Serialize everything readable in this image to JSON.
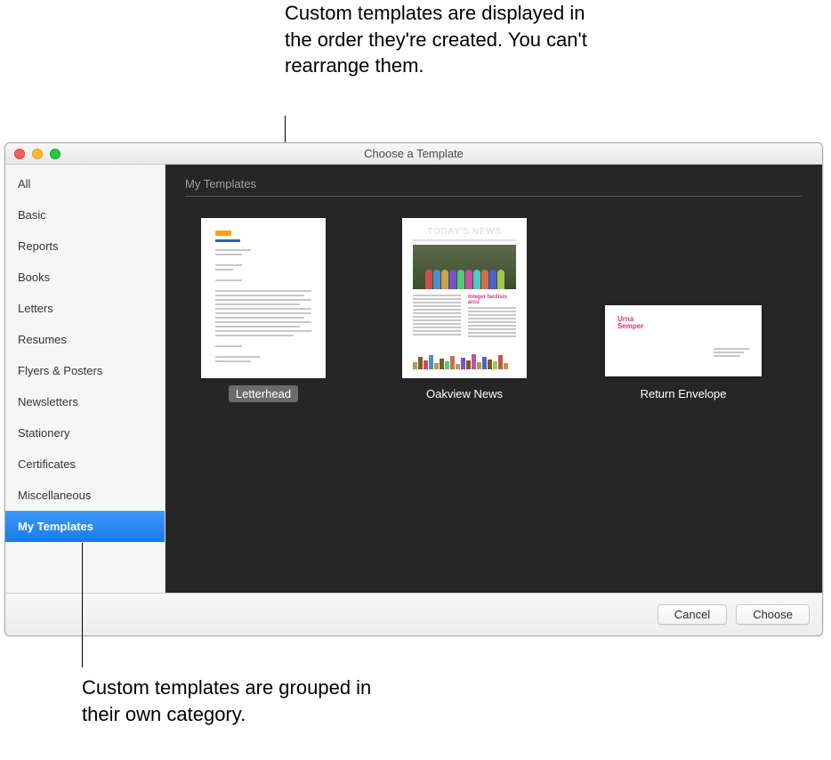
{
  "callouts": {
    "top": "Custom templates are displayed in the order they're created. You can't rearrange them.",
    "bottom": "Custom templates are grouped in their own category."
  },
  "window": {
    "title": "Choose a Template"
  },
  "sidebar": {
    "items": [
      {
        "label": "All"
      },
      {
        "label": "Basic"
      },
      {
        "label": "Reports"
      },
      {
        "label": "Books"
      },
      {
        "label": "Letters"
      },
      {
        "label": "Resumes"
      },
      {
        "label": "Flyers & Posters"
      },
      {
        "label": "Newsletters"
      },
      {
        "label": "Stationery"
      },
      {
        "label": "Certificates"
      },
      {
        "label": "Miscellaneous"
      },
      {
        "label": "My Templates"
      }
    ],
    "selected_index": 11
  },
  "section": {
    "header": "My Templates"
  },
  "templates": [
    {
      "label": "Letterhead",
      "selected": true,
      "kind": "letterhead"
    },
    {
      "label": "Oakview News",
      "selected": false,
      "kind": "newsletter"
    },
    {
      "label": "Return Envelope",
      "selected": false,
      "kind": "envelope"
    }
  ],
  "newsletter_preview": {
    "masthead": "TODAY'S NEWS",
    "headline": "Integer facilisis arcu"
  },
  "envelope_preview": {
    "name_line1": "Urna",
    "name_line2": "Semper"
  },
  "footer": {
    "cancel": "Cancel",
    "choose": "Choose"
  }
}
